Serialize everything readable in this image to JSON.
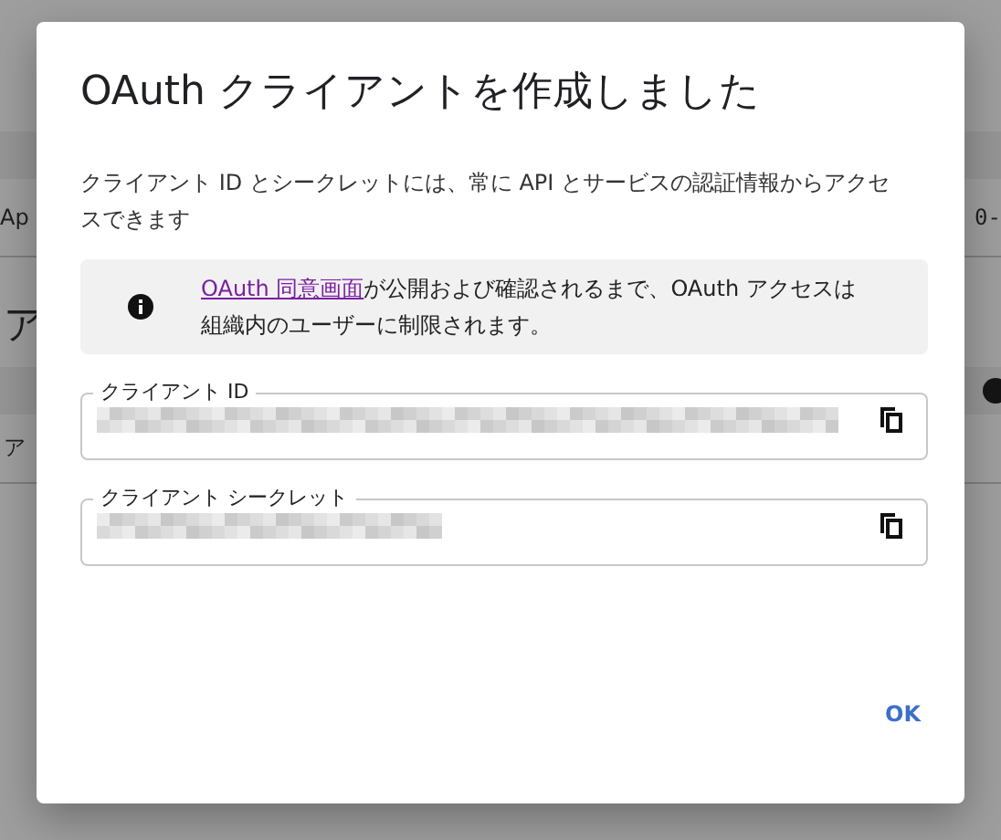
{
  "background": {
    "row_1_start": "Ap",
    "row_1_end": "0-",
    "heading_2": "ア",
    "row_2_start": "ア"
  },
  "dialog": {
    "title": "OAuth クライアントを作成しました",
    "description": "クライアント ID とシークレットには、常に API とサービスの認証情報からアクセスできます",
    "notice": {
      "link": "OAuth 同意画面",
      "text": "が公開および確認されるまで、OAuth アクセスは組織内のユーザーに制限されます。"
    },
    "fields": [
      {
        "label": "クライアント ID",
        "kind": "long"
      },
      {
        "label": "クライアント シークレット",
        "kind": "short"
      }
    ],
    "ok_button": "OK"
  }
}
